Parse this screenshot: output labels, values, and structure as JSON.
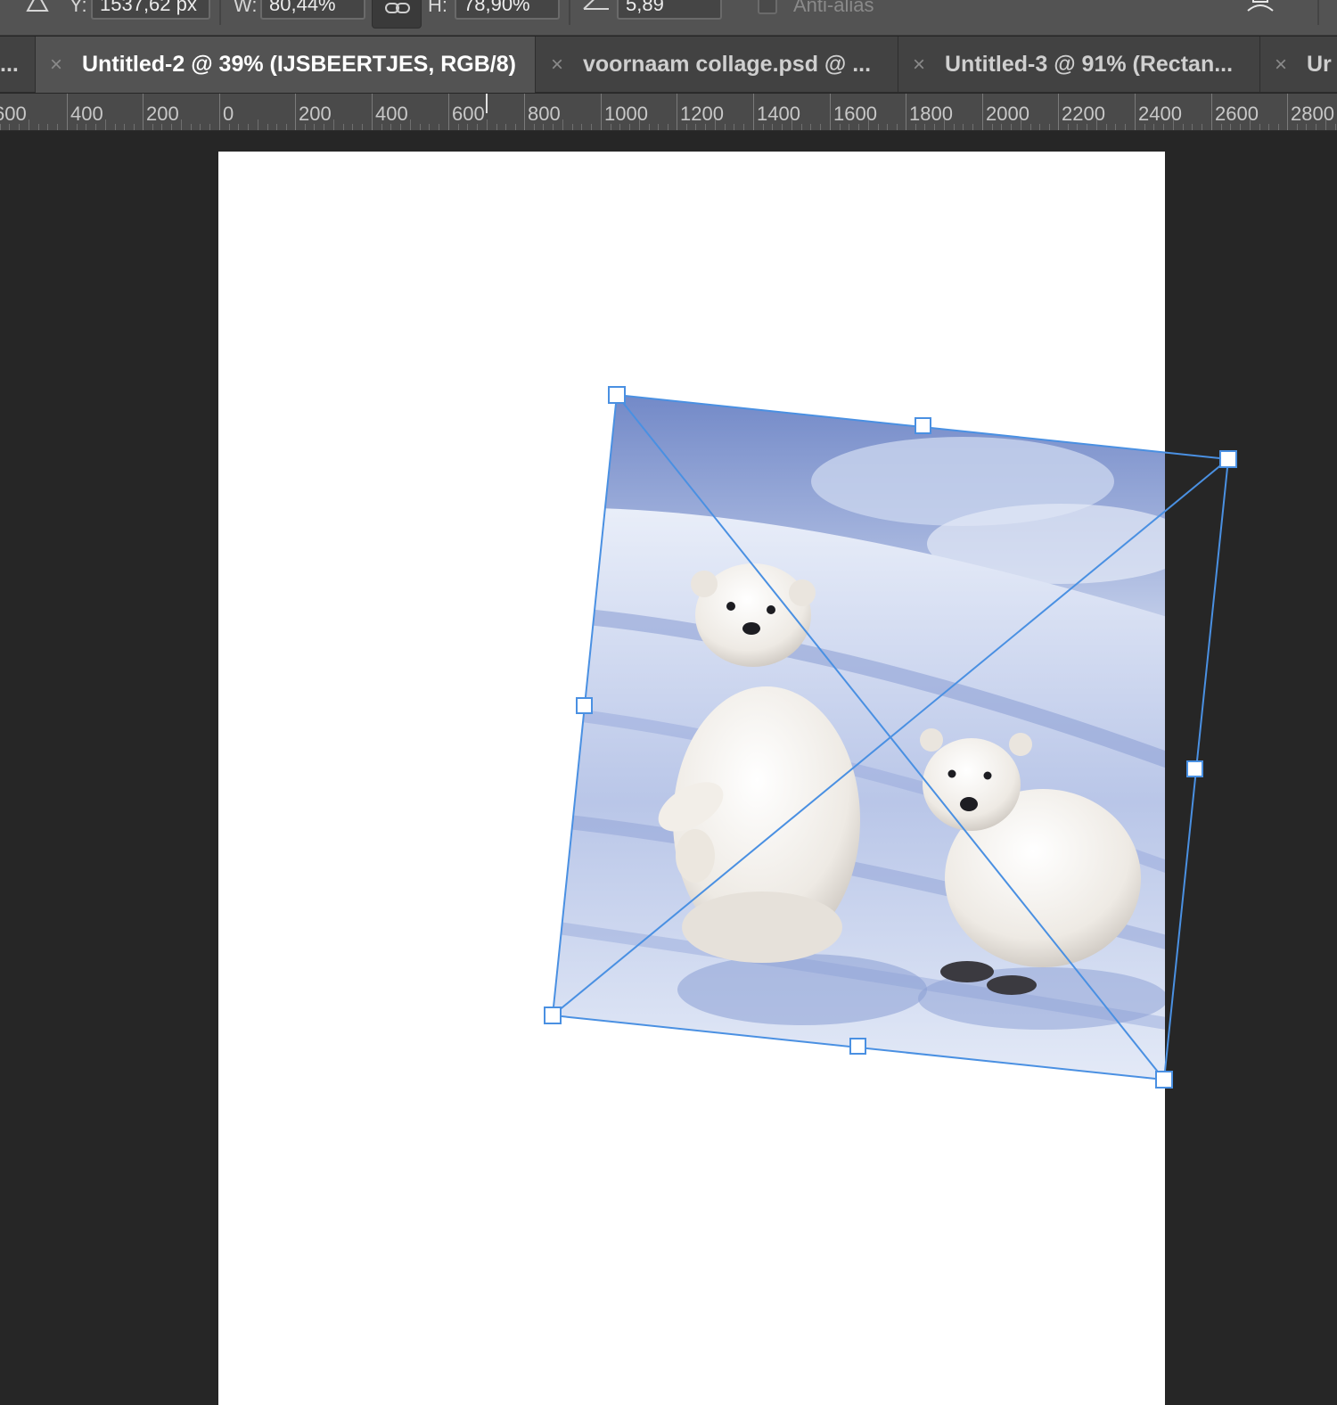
{
  "options_bar": {
    "y_label": "Y:",
    "y_value": "1537,62 px",
    "w_label": "W:",
    "w_value": "80,44%",
    "h_label": "H:",
    "h_value": "78,90%",
    "angle_value": "5,89",
    "degree_symbol": "°",
    "anti_alias_label": "Anti-alias"
  },
  "tabs": [
    {
      "close": "",
      "title": "..."
    },
    {
      "close": "×",
      "title": "Untitled-2 @ 39% (IJSBEERTJES, RGB/8)"
    },
    {
      "close": "×",
      "title": "voornaam collage.psd @ ..."
    },
    {
      "close": "×",
      "title": "Untitled-3 @ 91% (Rectan..."
    },
    {
      "close": "×",
      "title": "Ur"
    }
  ],
  "ruler": {
    "labels": [
      "600",
      "400",
      "200",
      "0",
      "200",
      "400",
      "600",
      "800",
      "1000",
      "1200",
      "1400",
      "1600",
      "1800",
      "2000",
      "2200",
      "2400",
      "2600",
      "2800"
    ]
  },
  "colors": {
    "workspace": "#262626",
    "selection": "#4a90e2",
    "document": "#ffffff"
  },
  "icons": {
    "skew": "triangle-skew-icon",
    "link": "link-chain-icon",
    "angle": "angle-icon",
    "warp": "warp-icon"
  }
}
